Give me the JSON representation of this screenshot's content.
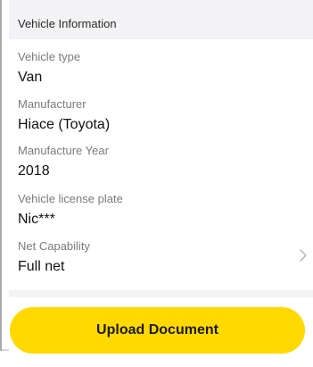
{
  "section": {
    "title": "Vehicle Information"
  },
  "fields": [
    {
      "label": "Vehicle type",
      "value": "Van"
    },
    {
      "label": "Manufacturer",
      "value": "Hiace (Toyota)"
    },
    {
      "label": "Manufacture Year",
      "value": "2018"
    },
    {
      "label": "Vehicle license plate",
      "value": "Nic***"
    },
    {
      "label": "Net Capability",
      "value": "Full net"
    }
  ],
  "actions": {
    "upload_label": "Upload Document"
  },
  "icons": {
    "row_chevron": "chevron-right-icon"
  },
  "colors": {
    "accent": "#ffd900",
    "section_background": "#f3f3f5",
    "label_text": "#7b7b7f",
    "value_text": "#111111"
  }
}
